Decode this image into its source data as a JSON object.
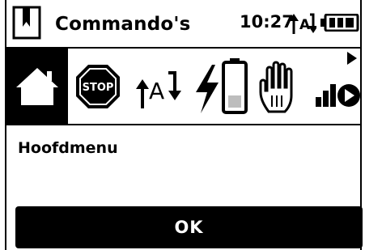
{
  "header": {
    "title": "Commando's",
    "time": "10:27",
    "battery_icon": "battery-full-icon",
    "text_input_icon": "abc-text-icon"
  },
  "toolbar": {
    "items": [
      {
        "icon": "home-icon",
        "selected": true
      },
      {
        "icon": "stop-sign-icon",
        "label": "STOP",
        "selected": false
      },
      {
        "icon": "text-mode-icon",
        "label": "A",
        "selected": false
      },
      {
        "icon": "battery-charging-icon",
        "selected": false
      },
      {
        "icon": "hand-icon",
        "selected": false
      },
      {
        "icon": "signal-play-icon",
        "selected": false
      }
    ],
    "more_icon": "arrow-right-icon"
  },
  "main": {
    "heading": "Hoofdmenu"
  },
  "ok_button": {
    "label": "OK"
  },
  "colors": {
    "foreground": "#000000",
    "background": "#ffffff",
    "battery_fill": "#bdbdbd"
  }
}
